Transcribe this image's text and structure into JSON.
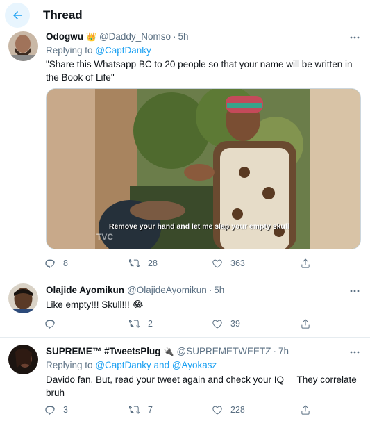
{
  "header": {
    "title": "Thread"
  },
  "tweets": [
    {
      "display_name": "Odogwu",
      "name_badge": "👑",
      "handle": "@Daddy_Nomso",
      "time": "5h",
      "replying_prefix": "Replying to",
      "replying_to": "@CaptDanky",
      "text": "\"Share this Whatsapp BC to 20 people so that your name will be written in the Book of Life\"",
      "media_caption": "Remove your hand and let me slap your empty skull",
      "media_watermark": "TVC",
      "replies": "8",
      "retweets": "28",
      "likes": "363"
    },
    {
      "display_name": "Olajide Ayomikun",
      "handle": "@OlajideAyomikun",
      "time": "5h",
      "text": "Like empty!!! Skull!!! 😂",
      "replies": "",
      "retweets": "2",
      "likes": "39"
    },
    {
      "display_name": "SUPREME™ #TweetsPlug",
      "name_badge": "🔌",
      "handle": "@SUPREMETWEETZ",
      "time": "7h",
      "replying_prefix": "Replying to",
      "replying_to": "@CaptDanky and @Ayokasz",
      "text": "Davido fan. But, read your tweet again and check your IQ     They correlate bruh",
      "replies": "3",
      "retweets": "7",
      "likes": "228"
    }
  ],
  "colors": {
    "accent": "#1da1f2",
    "muted": "#5b7083",
    "divider": "#e6ecf0"
  },
  "icons": [
    "back-arrow-icon",
    "more-icon",
    "reply-icon",
    "retweet-icon",
    "like-icon",
    "share-icon"
  ]
}
